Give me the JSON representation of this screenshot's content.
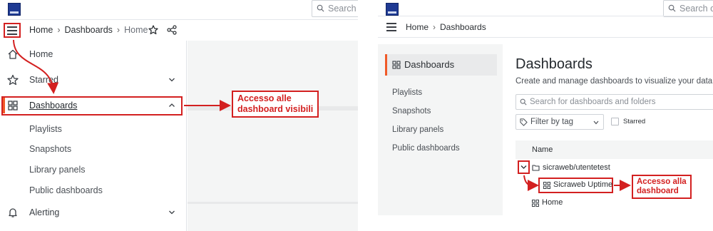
{
  "left": {
    "search_placeholder": "Search c",
    "breadcrumb": [
      "Home",
      "Dashboards",
      "Home"
    ],
    "nav": {
      "home": "Home",
      "starred": "Starred",
      "dashboards": "Dashboards",
      "sub_items": [
        "Playlists",
        "Snapshots",
        "Library panels",
        "Public dashboards"
      ],
      "alerting": "Alerting"
    },
    "callout": [
      "Accesso alle",
      "dashboard visibili"
    ]
  },
  "right": {
    "search_placeholder": "Search or ju",
    "breadcrumb": [
      "Home",
      "Dashboards"
    ],
    "sidebar": {
      "selected": "Dashboards",
      "items": [
        "Playlists",
        "Snapshots",
        "Library panels",
        "Public dashboards"
      ]
    },
    "title": "Dashboards",
    "subtitle": "Create and manage dashboards to visualize your data",
    "search_dash_placeholder": "Search for dashboards and folders",
    "filter_label": "Filter by tag",
    "starred_label": "Starred",
    "table_header": "Name",
    "folder": "sicraweb/utentetest",
    "dashboard_item": "Sicraweb Uptime",
    "home_item": "Home",
    "callout": [
      "Accesso alla",
      "dashboard"
    ]
  },
  "colors": {
    "highlight_red": "#d32020",
    "active_orange": "#f05a28"
  }
}
